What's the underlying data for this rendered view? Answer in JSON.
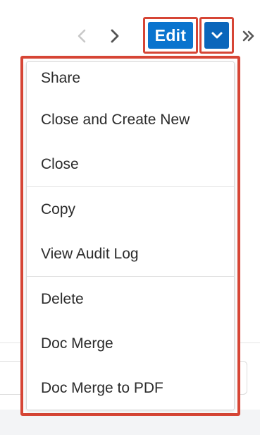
{
  "toolbar": {
    "prev_icon": "chevron-left-icon",
    "next_icon": "chevron-right-icon",
    "edit_label": "Edit",
    "actions_icon": "chevron-down-icon",
    "more_icon": "double-chevron-right-icon"
  },
  "dropdown": {
    "groups": [
      {
        "items": [
          {
            "label": "Share"
          },
          {
            "label": "Close and Create New"
          },
          {
            "label": "Close"
          }
        ]
      },
      {
        "items": [
          {
            "label": "Copy"
          },
          {
            "label": "View Audit Log"
          }
        ]
      },
      {
        "items": [
          {
            "label": "Delete"
          },
          {
            "label": "Doc Merge"
          },
          {
            "label": "Doc Merge to PDF"
          }
        ]
      }
    ]
  },
  "colors": {
    "primary_button": "#0a74ce",
    "highlight_outline": "#d64535",
    "nav_disabled": "#c8c8c8",
    "nav_enabled": "#555555",
    "menu_text": "#2b2b2b"
  }
}
